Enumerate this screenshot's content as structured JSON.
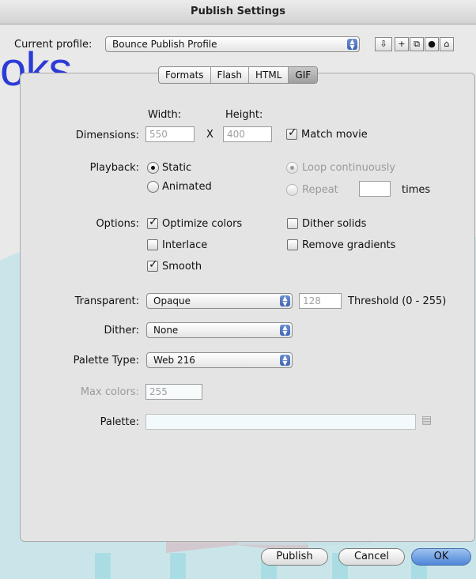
{
  "window": {
    "title": "Publish Settings"
  },
  "watermark": {
    "text": "oks",
    "logo_text": "DropBooks"
  },
  "profile": {
    "label": "Current profile:",
    "value": "Bounce Publish Profile",
    "icons": [
      "import-export-icon",
      "add-icon",
      "duplicate-icon",
      "info-icon",
      "trash-icon"
    ]
  },
  "tabs": [
    {
      "label": "Formats",
      "active": false
    },
    {
      "label": "Flash",
      "active": false
    },
    {
      "label": "HTML",
      "active": false
    },
    {
      "label": "GIF",
      "active": true
    }
  ],
  "dimensions": {
    "label": "Dimensions:",
    "width_label": "Width:",
    "height_label": "Height:",
    "width_value": "550",
    "height_value": "400",
    "separator": "X",
    "match_movie_label": "Match movie",
    "match_movie_checked": true
  },
  "playback": {
    "label": "Playback:",
    "static_label": "Static",
    "animated_label": "Animated",
    "selected": "static",
    "loop_label": "Loop continuously",
    "repeat_label": "Repeat",
    "times_label": "times",
    "repeat_value": ""
  },
  "options": {
    "label": "Options:",
    "items": [
      {
        "label": "Optimize colors",
        "checked": true
      },
      {
        "label": "Interlace",
        "checked": false
      },
      {
        "label": "Smooth",
        "checked": true
      },
      {
        "label": "Dither solids",
        "checked": false
      },
      {
        "label": "Remove gradients",
        "checked": false
      }
    ]
  },
  "transparent": {
    "label": "Transparent:",
    "value": "Opaque",
    "threshold_value": "128",
    "threshold_label": "Threshold (0 - 255)"
  },
  "dither": {
    "label": "Dither:",
    "value": "None"
  },
  "palette_type": {
    "label": "Palette Type:",
    "value": "Web 216"
  },
  "max_colors": {
    "label": "Max colors:",
    "value": "255"
  },
  "palette": {
    "label": "Palette:",
    "value": ""
  },
  "buttons": {
    "publish": "Publish",
    "cancel": "Cancel",
    "ok": "OK"
  },
  "colors": {
    "watermark_teal": "#a9dde3",
    "watermark_blue": "#2c3bd6",
    "default_button": "#4f86d9"
  }
}
